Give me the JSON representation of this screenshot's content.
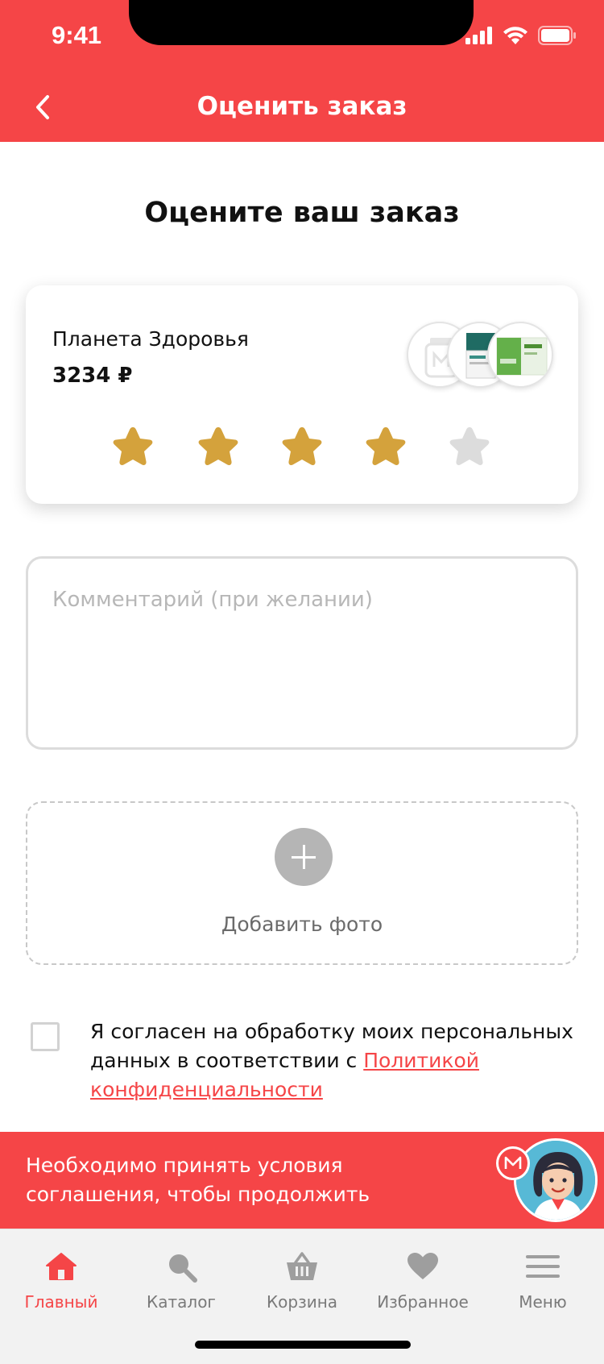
{
  "status_bar": {
    "time": "9:41"
  },
  "nav": {
    "title": "Оценить заказ"
  },
  "page": {
    "heading": "Оцените ваш заказ"
  },
  "order": {
    "store_name": "Планета Здоровья",
    "price": "3234 ₽",
    "product_thumbs": [
      "product-thumb-placeholder",
      "product-thumb-box",
      "product-thumb-orsoten"
    ],
    "rating": {
      "value": 4,
      "max": 5
    }
  },
  "comment": {
    "placeholder": "Комментарий (при желании)",
    "value": ""
  },
  "photo": {
    "label": "Добавить фото"
  },
  "consent": {
    "checked": false,
    "text": "Я согласен на обработку моих персональных данных в соответствии с ",
    "link": "Политикой конфиденциальности"
  },
  "alert": {
    "text": "Необходимо принять условия соглашения, чтобы продолжить"
  },
  "tabs": [
    {
      "label": "Главный",
      "icon": "home-icon",
      "active": true
    },
    {
      "label": "Каталог",
      "icon": "search-icon",
      "active": false
    },
    {
      "label": "Корзина",
      "icon": "basket-icon",
      "active": false
    },
    {
      "label": "Избранное",
      "icon": "heart-icon",
      "active": false
    },
    {
      "label": "Меню",
      "icon": "menu-icon",
      "active": false
    }
  ],
  "colors": {
    "accent": "#f54547",
    "star_filled": "#d4a23c",
    "star_empty": "#dcdcdc",
    "tab_inactive": "#7a7a7a"
  }
}
